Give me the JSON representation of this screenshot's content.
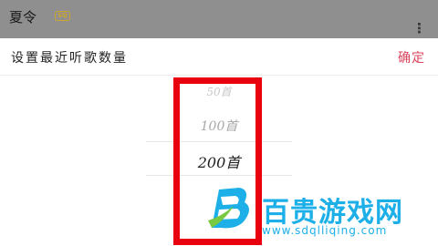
{
  "background_list": {
    "title": "夏令",
    "badge": "SQ"
  },
  "sheet": {
    "title": "设置最近听歌数量",
    "confirm_label": "确定"
  },
  "picker": {
    "options": [
      "50首",
      "100首",
      "200首",
      ""
    ],
    "selected": "200首"
  },
  "watermark": {
    "text": "百贵游戏网",
    "url": "www.sdqlliqing.com"
  },
  "colors": {
    "accent": "#d9465d",
    "highlight": "#e8000f",
    "watermark": "#1dafe8",
    "badge": "#cfa431"
  }
}
